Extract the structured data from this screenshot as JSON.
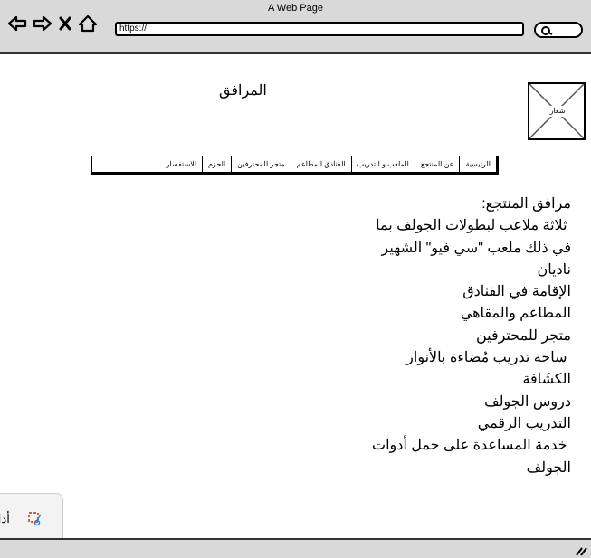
{
  "window": {
    "title": "A Web Page"
  },
  "url_bar": {
    "value": "https://"
  },
  "page": {
    "heading": "المرافق",
    "logo_label": "شعار"
  },
  "nav": [
    "الرئيسية",
    "عن المنتجع",
    "الملعب و التدريب",
    "الفنادق المطاعم",
    "متجر للمحترفين",
    "الحزم",
    "الاستفسار"
  ],
  "facilities": {
    "title": "مرافق المنتجع:",
    "lines": [
      " ثلاثة ملاعب لبطولات الجولف بما",
      "في ذلك ملعب \"سي فيو\" الشهير",
      "ناديان",
      "الإقامة في الفنادق",
      "المطاعم والمقاهي",
      "متجر للمحترفين",
      " ساحة تدريب مُضاءة بالأنوار",
      "الكشَافة",
      "دروس الجولف",
      "التدريب الرقمي",
      " خدمة المساعدة على حمل أدوات",
      "الجولف"
    ]
  },
  "tool_panel": {
    "label": "أداة"
  },
  "icons": {
    "back": "back-arrow-icon",
    "forward": "forward-arrow-icon",
    "close": "close-x-icon",
    "home": "home-icon",
    "search": "search-icon",
    "tool": "snipping-tool-icon",
    "resize": "resize-grip-icon"
  }
}
